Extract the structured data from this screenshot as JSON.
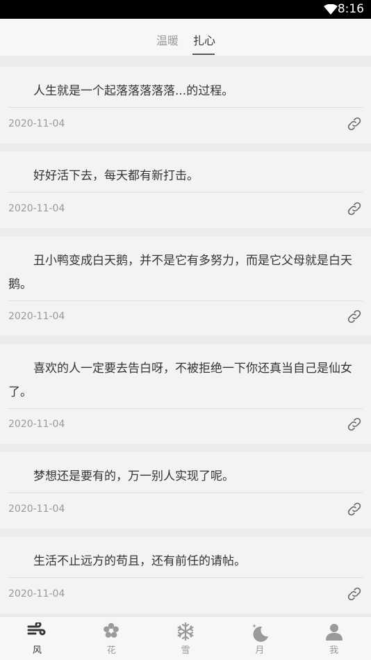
{
  "status": {
    "time": "8:16"
  },
  "tabs": [
    {
      "label": "温暖"
    },
    {
      "label": "扎心"
    }
  ],
  "posts": [
    {
      "text": "人生就是一个起落落落落落...的过程。",
      "date": "2020-11-04"
    },
    {
      "text": "好好活下去，每天都有新打击。",
      "date": "2020-11-04"
    },
    {
      "text": "丑小鸭变成白天鹅，并不是它有多努力，而是它父母就是白天鹅。",
      "date": "2020-11-04"
    },
    {
      "text": "喜欢的人一定要去告白呀，不被拒绝一下你还真当自己是仙女了。",
      "date": "2020-11-04"
    },
    {
      "text": "梦想还是要有的，万一别人实现了呢。",
      "date": "2020-11-04"
    },
    {
      "text": "生活不止远方的苟且，还有前任的请帖。",
      "date": "2020-11-04"
    }
  ],
  "nav": [
    {
      "label": "风",
      "icon": "wind-icon"
    },
    {
      "label": "花",
      "icon": "flower-icon"
    },
    {
      "label": "雪",
      "icon": "snowflake-icon"
    },
    {
      "label": "月",
      "icon": "moon-icon"
    },
    {
      "label": "我",
      "icon": "user-icon"
    }
  ],
  "colors": {
    "active": "#333333",
    "inactive": "#999999"
  }
}
